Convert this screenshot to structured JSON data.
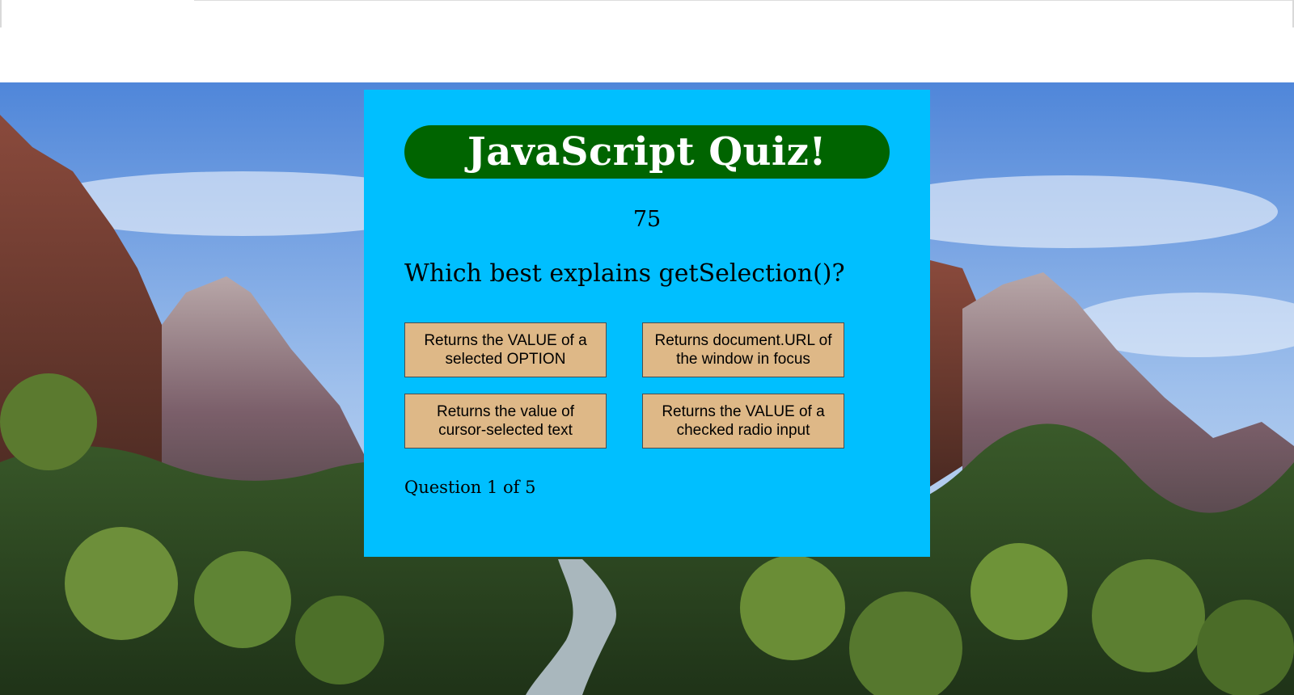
{
  "quiz": {
    "title": "JavaScript Quiz!",
    "timer": "75",
    "question": "Which best explains getSelection()?",
    "answers": [
      "Returns the VALUE of a selected OPTION",
      "Returns document.URL of the window in focus",
      "Returns the value of cursor-selected text",
      "Returns the VALUE of a checked radio input"
    ],
    "progress": "Question 1 of 5"
  },
  "colors": {
    "card_background": "#00bfff",
    "title_background": "#006400",
    "title_text": "#ffffff",
    "answer_background": "#deb887"
  },
  "background_image": "mountain-canyon-landscape"
}
